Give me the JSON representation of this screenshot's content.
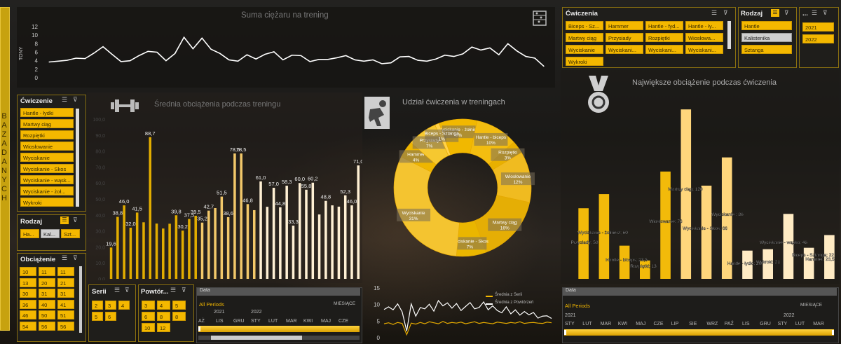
{
  "side_label": "BAZA DANYCH",
  "top_chart": {
    "title": "Suma ciężaru na trening",
    "ylabel": "TONY",
    "yticks": [
      "12",
      "10",
      "8",
      "6",
      "4",
      "2",
      "0"
    ]
  },
  "avg_chart": {
    "title": "Średnia obciążenia podczas treningu",
    "yticks": [
      "100,0",
      "90,0",
      "80,0",
      "70,0",
      "60,0",
      "50,0",
      "40,0",
      "30,0",
      "20,0",
      "10,0",
      "0,0"
    ]
  },
  "donut_chart": {
    "title": "Udział ćwiczenia w treningach"
  },
  "max_chart": {
    "title": "Największe obciążenie podczas ćwiczenia"
  },
  "line2_legend": {
    "a": "Średnia z Serii",
    "b": "Średnia z Powtórzeń"
  },
  "line2_yticks": [
    "15",
    "10",
    "5",
    "0"
  ],
  "slicer_exercise_top": {
    "title": "Ćwiczenia",
    "items": [
      "Biceps - Sz...",
      "Hammer",
      "Hantle - fyd...",
      "Hantle - ły...",
      "Martwy ciąg",
      "Przysiady",
      "Rozpiętki",
      "Wiosłowa...",
      "Wyciskanie",
      "Wyciskani...",
      "Wyciskani...",
      "Wyciskani...",
      "Wykroki"
    ]
  },
  "slicer_kind_top": {
    "title": "Rodzaj",
    "items": [
      "Hantle",
      "Kalistenika",
      "Sztanga"
    ]
  },
  "slicer_year_top": {
    "title": "...",
    "items": [
      "2021",
      "2022"
    ]
  },
  "slicer_exercise_left": {
    "title": "Ćwiczenie",
    "items": [
      "Hantle - łydki",
      "Martwy ciąg",
      "Rozpiętki",
      "Wiosłowanie",
      "Wyciskanie",
      "Wyciskanie - Skos",
      "Wyciskanie - wąsk...",
      "Wyciskanie - żoł...",
      "Wykroki"
    ]
  },
  "slicer_kind_left": {
    "title": "Rodzaj",
    "items": [
      "Ha...",
      "Kal...",
      "Szt..."
    ]
  },
  "slicer_weight": {
    "title": "Obciążenie",
    "items": [
      "10",
      "11",
      "11",
      "13",
      "20",
      "21",
      "30",
      "31",
      "31",
      "36",
      "40",
      "41",
      "46",
      "50",
      "51",
      "54",
      "56",
      "56"
    ]
  },
  "slicer_series": {
    "title": "Serii",
    "items": [
      "2",
      "3",
      "4",
      "5",
      "6"
    ]
  },
  "slicer_reps": {
    "title": "Powtór...",
    "items": [
      "3",
      "4",
      "5",
      "6",
      "8",
      "8",
      "10",
      "12"
    ]
  },
  "timeline_left": {
    "header": "Data",
    "period": "All Periods",
    "unit": "MIESIĄCE",
    "years": [
      "2021",
      "2022"
    ],
    "months": [
      "AŻ",
      "LIS",
      "GRU",
      "STY",
      "LUT",
      "MAR",
      "KWI",
      "MAJ",
      "CZE"
    ]
  },
  "timeline_right": {
    "header": "Data",
    "period": "All Periods",
    "unit": "MIESIĄCE",
    "years": [
      "2021",
      "2022"
    ],
    "months": [
      "STY",
      "LUT",
      "MAR",
      "KWI",
      "MAJ",
      "CZE",
      "LIP",
      "SIE",
      "WRZ",
      "PAŹ",
      "LIS",
      "GRU",
      "STY",
      "LUT",
      "MAR"
    ]
  },
  "colors": {
    "accent": "#f4b800",
    "light": "#ffe0a0",
    "pale": "#fff1d6",
    "dark": "#c9951a"
  },
  "chart_data": [
    {
      "type": "line",
      "title": "Suma ciężaru na trening",
      "ylabel": "TONY",
      "ylim": [
        0,
        12
      ],
      "series": [
        {
          "values": [
            3.7,
            3.9,
            4.1,
            4.6,
            4.5,
            5.8,
            7.3,
            5.5,
            3.8,
            4.0,
            5.2,
            6.2,
            6.0,
            4.0,
            5.7,
            9.5,
            6.8,
            9.3,
            6.7,
            5.7,
            4.2,
            3.9,
            5.4,
            4.4,
            5.5,
            6.1,
            4.2,
            5.3,
            5.2,
            3.8,
            4.3,
            4.3,
            4.7,
            5.2,
            4.2,
            3.9,
            4.2,
            3.3,
            3.5,
            4.9,
            5.0,
            4.1,
            3.9,
            4.4,
            5.3,
            5.0,
            5.6,
            7.2,
            6.5,
            7.0,
            5.4,
            8.0,
            6.3,
            5.0,
            4.6,
            2.7
          ]
        }
      ]
    },
    {
      "type": "bar",
      "title": "Średnia obciążenia podczas treningu",
      "ylim": [
        0,
        100
      ],
      "values": [
        19.6,
        38.8,
        46.0,
        32.0,
        41.5,
        35.4,
        88.7,
        34.6,
        31.5,
        34.5,
        39.8,
        30.2,
        37.5,
        39.5,
        35.2,
        42.7,
        44.3,
        51.5,
        38.6,
        78.5,
        78.5,
        46.8,
        43.0,
        61.0,
        45.1,
        57.0,
        44.8,
        58.3,
        33.3,
        60.0,
        55.8,
        60.2,
        40.3,
        48.8,
        46.0,
        45.2,
        52.3,
        46.0,
        71.0
      ],
      "labels": [
        "19,6",
        "38,8",
        "46,0",
        "32,0",
        "41,5",
        "",
        "88,7",
        "",
        "",
        "",
        "39,8",
        "30,2",
        "37,5",
        "39,5",
        "35,2",
        "42,7",
        "",
        "51,5",
        "38,6",
        "78,5",
        "78,5",
        "46,8",
        "",
        "61,0",
        "",
        "57,0",
        "44,8",
        "58,3",
        "33,3",
        "60,0",
        "55,8",
        "60,2",
        "",
        "48,8",
        "",
        "",
        "52,3",
        "46,0",
        "71,0"
      ]
    },
    {
      "type": "pie",
      "title": "Udział ćwiczenia w treningach",
      "slices": [
        {
          "name": "Wyciskanie - żołnierz",
          "value": 9
        },
        {
          "name": "Hantle - biceps",
          "value": 10
        },
        {
          "name": "Rozpiętki",
          "value": 3
        },
        {
          "name": "Wiosłowanie",
          "value": 12
        },
        {
          "name": "Martwy ciąg",
          "value": 16
        },
        {
          "name": "Wyciskanie - Skos",
          "value": 7
        },
        {
          "name": "Wyciskanie",
          "value": 31
        },
        {
          "name": "Hammer",
          "value": 4
        },
        {
          "name": "Przysiady",
          "value": 7
        },
        {
          "name": "Biceps - Sztanga",
          "value": 1
        }
      ],
      "labels": [
        "Wyciskanie - żołnierz\n9%",
        "Hantle - biceps\n10%",
        "Rozpiętki\n3%",
        "Wiosłowanie\n12%",
        "Martwy ciąg\n16%",
        "Wyciskanie - Skos\n7%",
        "Wyciskanie\n31%",
        "Hammer\n4%",
        "Przysiady\n7%",
        "Biceps - Sztanga\n1%"
      ]
    },
    {
      "type": "bar",
      "title": "Największe obciążenie podczas ćwiczenia",
      "ylim": [
        0,
        130
      ],
      "categories": [
        "Przysiady",
        "Wyciskanie - żołnierz",
        "Hantle - biceps",
        "Rozpiętki",
        "Wiosłowanie",
        "Martwy ciąg",
        "Wyciskanie - Skos",
        "Wyciskanie",
        "Hantle - łydki",
        "Wykroki",
        "Wyciskanie - wąsko",
        "Biceps - Sztanga",
        "Hammer"
      ],
      "values": [
        50,
        60,
        23.5,
        13,
        76,
        120,
        66,
        86,
        20,
        21,
        46,
        22,
        31
      ],
      "labels": [
        "Przysiady; 50",
        "Wyciskanie - żołnierz; 60",
        "Hantle - biceps; 23,5",
        "Rozpiętki; 13",
        "Wiosłowanie; 76",
        "Martwy ciąg; 120",
        "Wyciskanie - Skos; 66",
        "Wyciskanie ; 86",
        "Hantle - łydki; 20",
        "Wykroki; 21",
        "Wyciskanie - wąsko; 46",
        "Biceps - Sztanga; 22",
        "Hammer; 23,5"
      ]
    },
    {
      "type": "line",
      "ylim": [
        0,
        15
      ],
      "series": [
        {
          "name": "Średnia z Serii",
          "values": [
            4.2,
            4.5,
            4.0,
            4.6,
            4.3,
            0.9,
            4.4,
            4.1,
            4.6,
            4.2,
            4.8,
            4.5,
            4.2,
            4.9,
            4.3,
            4.6,
            4.4,
            4.7,
            4.2,
            4.5,
            4.8,
            4.3,
            4.6,
            4.4,
            4.2,
            4.7,
            4.5,
            4.3,
            4.6,
            4.4,
            4.8,
            4.3,
            4.5,
            4.6,
            4.4,
            4.3,
            4.7,
            4.5
          ]
        },
        {
          "name": "Średnia z Powtórzeń",
          "values": [
            8.5,
            9.3,
            8.4,
            10.2,
            7.8,
            2.0,
            10.2,
            6.5,
            9.1,
            8.7,
            10.1,
            8.0,
            11.2,
            9.6,
            10.5,
            8.9,
            10.3,
            8.2,
            9.4,
            10.6,
            8.7,
            9.1,
            10.8,
            8.4,
            9.6,
            8.2,
            7.5,
            9.3,
            7.2,
            8.4,
            6.8,
            7.9,
            6.9,
            7.6,
            5.9,
            6.5,
            6.6,
            5.8
          ]
        }
      ]
    }
  ]
}
